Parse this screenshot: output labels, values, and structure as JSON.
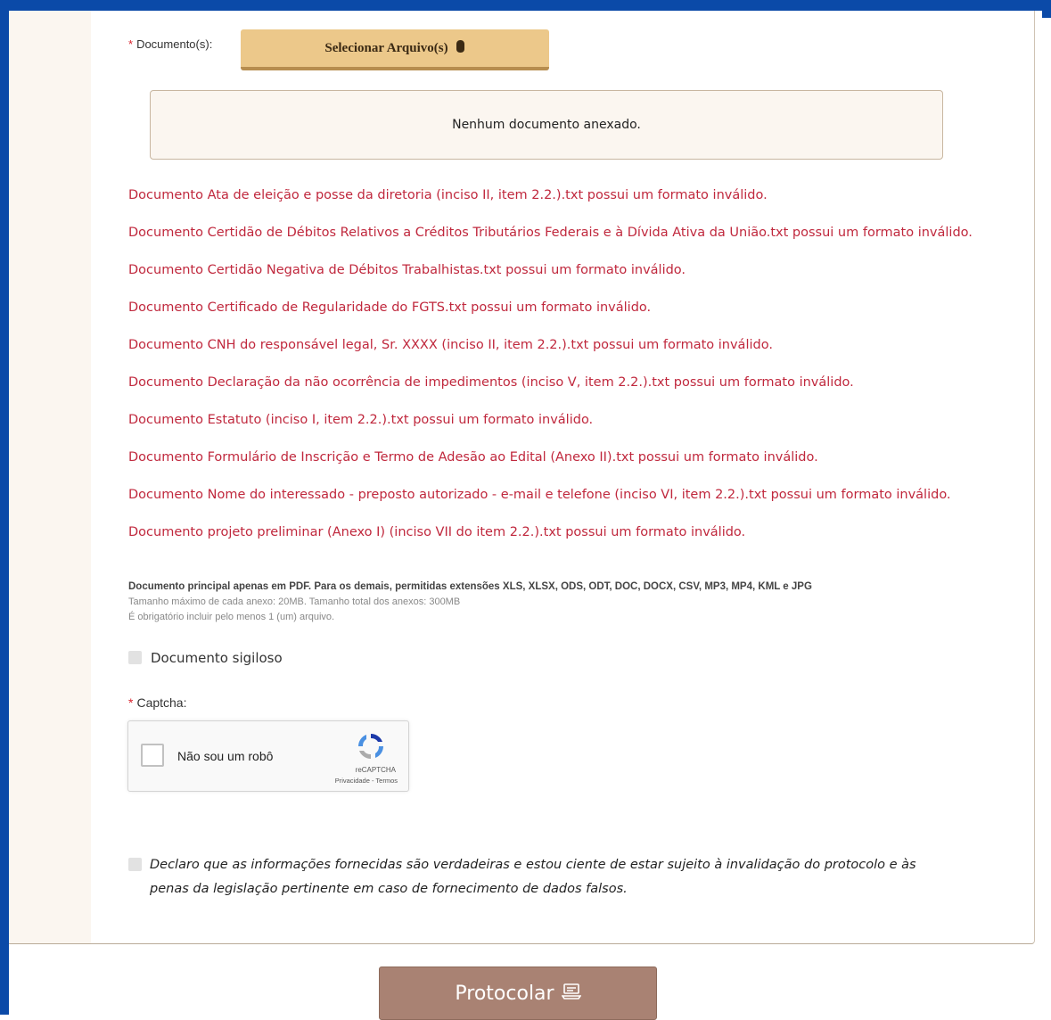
{
  "documents": {
    "label": "Documento(s):",
    "required_mark": "*",
    "select_button": "Selecionar Arquivo(s)",
    "empty_message": "Nenhum documento anexado."
  },
  "errors": [
    "Documento Ata de eleição e posse da diretoria (inciso II, item 2.2.).txt possui um formato inválido.",
    "Documento Certidão de Débitos Relativos a Créditos Tributários Federais e à Dívida Ativa da União.txt possui um formato inválido.",
    "Documento Certidão Negativa de Débitos Trabalhistas.txt possui um formato inválido.",
    "Documento Certificado de Regularidade do FGTS.txt possui um formato inválido.",
    "Documento CNH do responsável legal, Sr. XXXX (inciso II, item 2.2.).txt possui um formato inválido.",
    "Documento Declaração da não ocorrência de impedimentos (inciso V, item 2.2.).txt possui um formato inválido.",
    "Documento Estatuto (inciso I, item 2.2.).txt possui um formato inválido.",
    "Documento Formulário de Inscrição e Termo de Adesão ao Edital (Anexo II).txt possui um formato inválido.",
    "Documento Nome do interessado - preposto autorizado - e-mail e telefone (inciso VI, item 2.2.).txt possui um formato inválido.",
    "Documento projeto preliminar (Anexo I) (inciso VII do item 2.2.).txt possui um formato inválido."
  ],
  "hints": {
    "formats": "Documento principal apenas em PDF. Para os demais, permitidas extensões XLS, XLSX, ODS, ODT, DOC, DOCX, CSV, MP3, MP4, KML e JPG",
    "sizes": "Tamanho máximo de cada anexo: 20MB. Tamanho total dos anexos: 300MB",
    "required": "É obrigatório incluir pelo menos 1 (um) arquivo."
  },
  "confidential": {
    "label": "Documento sigiloso",
    "checked": false
  },
  "captcha": {
    "label": "Captcha:",
    "required_mark": "*",
    "checkbox_label": "Não sou um robô",
    "brand": "reCAPTCHA",
    "links": "Privacidade - Termos"
  },
  "declaration": {
    "text": "Declaro que as informações fornecidas são verdadeiras e estou ciente de estar sujeito à invalidação do protocolo e às penas da legislação pertinente em caso de fornecimento de dados falsos.",
    "checked": false
  },
  "submit": {
    "label": "Protocolar"
  },
  "colors": {
    "frame": "#0b4aa8",
    "error_text": "#c0283d",
    "select_button": "#ecc88a",
    "submit_button": "#a98273",
    "required": "#d9232d"
  }
}
